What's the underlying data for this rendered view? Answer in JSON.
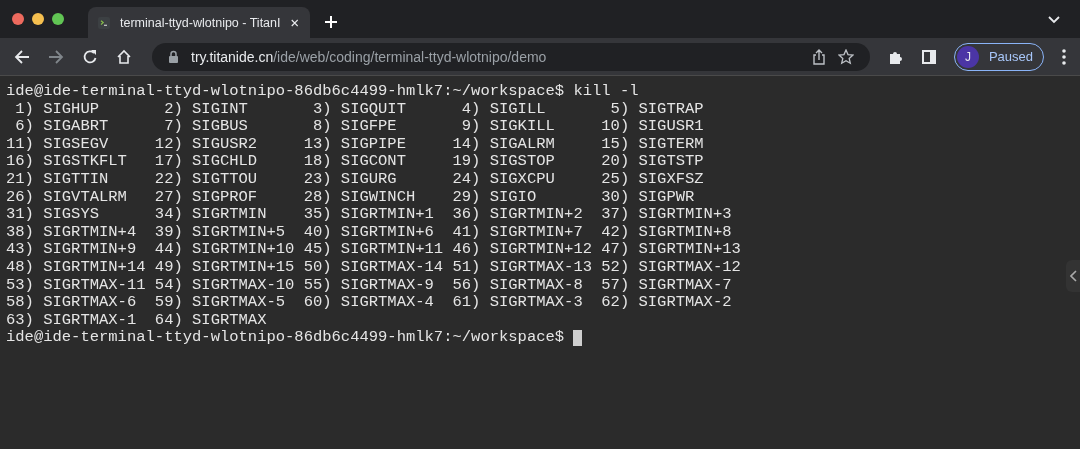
{
  "tabs": [
    {
      "title": "terminal-ttyd-wlotnipo - TitanI",
      "selected": true
    }
  ],
  "address": {
    "host": "try.titanide.cn",
    "path": "/ide/web/coding/terminal-ttyd-wlotnipo/demo"
  },
  "profile": {
    "initial": "J",
    "status": "Paused"
  },
  "terminal": {
    "lines": [
      "ide@ide-terminal-ttyd-wlotnipo-86db6c4499-hmlk7:~/workspace$ kill -l",
      " 1) SIGHUP       2) SIGINT       3) SIGQUIT      4) SIGILL       5) SIGTRAP",
      " 6) SIGABRT      7) SIGBUS       8) SIGFPE       9) SIGKILL     10) SIGUSR1",
      "11) SIGSEGV     12) SIGUSR2     13) SIGPIPE     14) SIGALRM     15) SIGTERM",
      "16) SIGSTKFLT   17) SIGCHLD     18) SIGCONT     19) SIGSTOP     20) SIGTSTP",
      "21) SIGTTIN     22) SIGTTOU     23) SIGURG      24) SIGXCPU     25) SIGXFSZ",
      "26) SIGVTALRM   27) SIGPROF     28) SIGWINCH    29) SIGIO       30) SIGPWR",
      "31) SIGSYS      34) SIGRTMIN    35) SIGRTMIN+1  36) SIGRTMIN+2  37) SIGRTMIN+3",
      "38) SIGRTMIN+4  39) SIGRTMIN+5  40) SIGRTMIN+6  41) SIGRTMIN+7  42) SIGRTMIN+8",
      "43) SIGRTMIN+9  44) SIGRTMIN+10 45) SIGRTMIN+11 46) SIGRTMIN+12 47) SIGRTMIN+13",
      "48) SIGRTMIN+14 49) SIGRTMIN+15 50) SIGRTMAX-14 51) SIGRTMAX-13 52) SIGRTMAX-12",
      "53) SIGRTMAX-11 54) SIGRTMAX-10 55) SIGRTMAX-9  56) SIGRTMAX-8  57) SIGRTMAX-7",
      "58) SIGRTMAX-6  59) SIGRTMAX-5  60) SIGRTMAX-4  61) SIGRTMAX-3  62) SIGRTMAX-2",
      "63) SIGRTMAX-1  64) SIGRTMAX",
      "ide@ide-terminal-ttyd-wlotnipo-86db6c4499-hmlk7:~/workspace$ "
    ],
    "cursor": true
  }
}
